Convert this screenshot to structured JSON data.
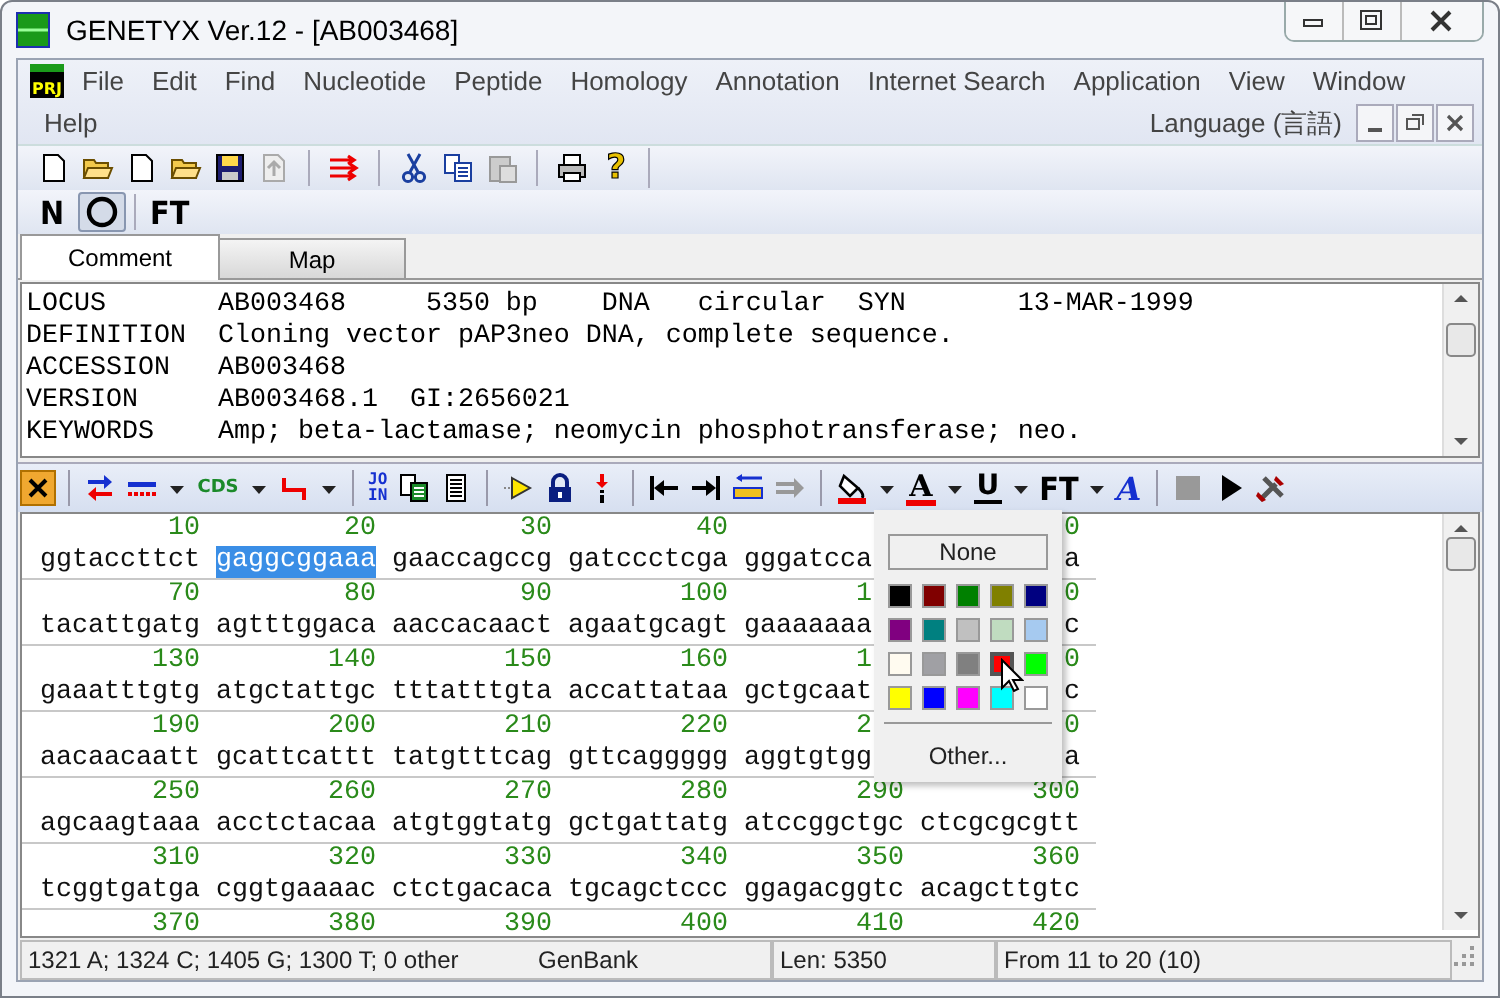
{
  "window": {
    "title": "GENETYX Ver.12 - [AB003468]"
  },
  "menubar": {
    "badge": "PRJ",
    "items": [
      "File",
      "Edit",
      "Find",
      "Nucleotide",
      "Peptide",
      "Homology",
      "Annotation",
      "Internet Search",
      "Application",
      "View",
      "Window",
      "Help"
    ],
    "language": "Language (言語)"
  },
  "toolbar": {
    "help_glyph": "?"
  },
  "view_modes": [
    {
      "kind": "text",
      "label": "N",
      "selected": false
    },
    {
      "kind": "circle",
      "selected": true
    },
    {
      "kind": "text",
      "label": "FT",
      "selected": false
    }
  ],
  "tabs": [
    {
      "label": "Comment",
      "selected": true
    },
    {
      "label": "Map",
      "selected": false
    }
  ],
  "comment": [
    {
      "key": "LOCUS",
      "value": "AB003468     5350 bp    DNA   circular  SYN       13-MAR-1999"
    },
    {
      "key": "DEFINITION",
      "value": "Cloning vector pAP3neo DNA, complete sequence."
    },
    {
      "key": "ACCESSION",
      "value": "AB003468"
    },
    {
      "key": "VERSION",
      "value": "AB003468.1  GI:2656021"
    },
    {
      "key": "KEYWORDS",
      "value": "Amp; beta-lactamase; neomycin phosphotransferase; neo."
    }
  ],
  "edit_toolbar": {
    "cds": "CDS",
    "join": "JOIN",
    "text_color": "A",
    "underline": "U",
    "font": "FT",
    "italic": "A"
  },
  "sequence": {
    "rows": [
      {
        "blocks": [
          {
            "num": "10",
            "seq": "ggtaccttct",
            "selected": false
          },
          {
            "num": "20",
            "seq": "gaggcggaaa",
            "selected": true
          },
          {
            "num": "30",
            "seq": "gaaccagccg",
            "selected": false
          },
          {
            "num": "40",
            "seq": "gatccctcga",
            "selected": false
          },
          {
            "seq": "gggatcca",
            "selected": false
          },
          {
            "num": "0",
            "seq": "a",
            "selected": false
          }
        ]
      },
      {
        "blocks": [
          {
            "num": "70",
            "seq": "tacattgatg",
            "selected": false
          },
          {
            "num": "80",
            "seq": "agtttggaca",
            "selected": false
          },
          {
            "num": "90",
            "seq": "aaccacaact",
            "selected": false
          },
          {
            "num": "100",
            "seq": "agaatgcagt",
            "selected": false
          },
          {
            "num": "1",
            "seq": "gaaaaaaa",
            "selected": false
          },
          {
            "num": "0",
            "seq": "c",
            "selected": false
          }
        ]
      },
      {
        "blocks": [
          {
            "num": "130",
            "seq": "gaaatttgtg",
            "selected": false
          },
          {
            "num": "140",
            "seq": "atgctattgc",
            "selected": false
          },
          {
            "num": "150",
            "seq": "tttatttgta",
            "selected": false
          },
          {
            "num": "160",
            "seq": "accattataa",
            "selected": false
          },
          {
            "num": "1",
            "seq": "gctgcaat",
            "selected": false
          },
          {
            "num": "0",
            "seq": "c",
            "selected": false
          }
        ]
      },
      {
        "blocks": [
          {
            "num": "190",
            "seq": "aacaacaatt",
            "selected": false
          },
          {
            "num": "200",
            "seq": "gcattcattt",
            "selected": false
          },
          {
            "num": "210",
            "seq": "tatgtttcag",
            "selected": false
          },
          {
            "num": "220",
            "seq": "gttcaggggg",
            "selected": false
          },
          {
            "num": "2",
            "seq": "aggtgtgg",
            "selected": false
          },
          {
            "num": "0",
            "seq": "a",
            "selected": false
          }
        ]
      },
      {
        "blocks": [
          {
            "num": "250",
            "seq": "agcaagtaaa",
            "selected": false
          },
          {
            "num": "260",
            "seq": "acctctacaa",
            "selected": false
          },
          {
            "num": "270",
            "seq": "atgtggtatg",
            "selected": false
          },
          {
            "num": "280",
            "seq": "gctgattatg",
            "selected": false
          },
          {
            "num": "290",
            "seq": "atccggctgc",
            "selected": false
          },
          {
            "num": "300",
            "seq": "ctcgcgcgtt",
            "selected": false
          }
        ]
      },
      {
        "blocks": [
          {
            "num": "310",
            "seq": "tcggtgatga",
            "selected": false
          },
          {
            "num": "320",
            "seq": "cggtgaaaac",
            "selected": false
          },
          {
            "num": "330",
            "seq": "ctctgacaca",
            "selected": false
          },
          {
            "num": "340",
            "seq": "tgcagctccc",
            "selected": false
          },
          {
            "num": "350",
            "seq": "ggagacggtc",
            "selected": false
          },
          {
            "num": "360",
            "seq": "acagcttgtc",
            "selected": false
          }
        ]
      },
      {
        "blocks": [
          {
            "num": "370"
          },
          {
            "num": "380"
          },
          {
            "num": "390"
          },
          {
            "num": "400"
          },
          {
            "num": "410"
          },
          {
            "num": "420"
          }
        ]
      }
    ]
  },
  "color_popup": {
    "none_label": "None",
    "other_label": "Other...",
    "swatches": [
      {
        "color": "#000000",
        "selected": false
      },
      {
        "color": "#800000",
        "selected": false
      },
      {
        "color": "#008000",
        "selected": false
      },
      {
        "color": "#808000",
        "selected": false
      },
      {
        "color": "#000080",
        "selected": false
      },
      {
        "color": "#800080",
        "selected": false
      },
      {
        "color": "#008080",
        "selected": false
      },
      {
        "color": "#c0c0c0",
        "selected": false
      },
      {
        "color": "#c0dcc0",
        "selected": false
      },
      {
        "color": "#a6caf0",
        "selected": false
      },
      {
        "color": "#fffbf0",
        "selected": false
      },
      {
        "color": "#a0a0a4",
        "selected": false
      },
      {
        "color": "#808080",
        "selected": false
      },
      {
        "color": "#ff0000",
        "selected": true
      },
      {
        "color": "#00ff00",
        "selected": false
      },
      {
        "color": "#ffff00",
        "selected": false
      },
      {
        "color": "#0000ff",
        "selected": false
      },
      {
        "color": "#ff00ff",
        "selected": false
      },
      {
        "color": "#00ffff",
        "selected": false
      },
      {
        "color": "#ffffff",
        "selected": false
      }
    ]
  },
  "status_bar": [
    "1321 A; 1324 C; 1405 G; 1300 T; 0 other",
    "GenBank",
    "Len: 5350",
    "From 11 to 20 (10)"
  ]
}
